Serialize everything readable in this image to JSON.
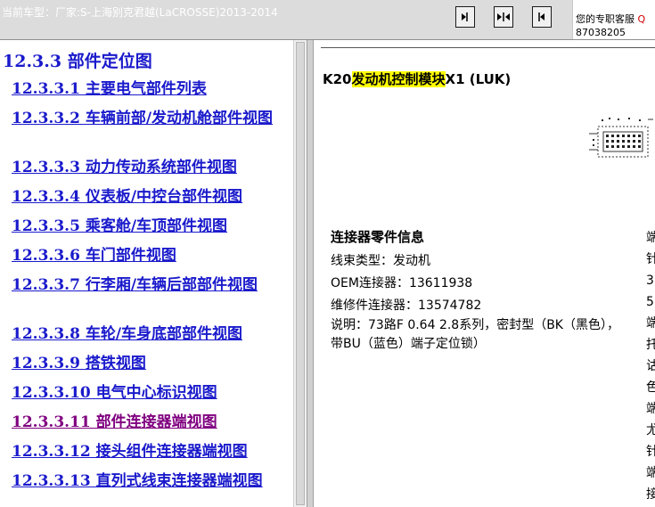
{
  "header": {
    "car_label": "当前车型：厂家:S-上海别克君越(LaCROSSE)2013-2014",
    "nav_buttons": [
      "prev-page",
      "sync-toc",
      "next-page"
    ]
  },
  "support": {
    "label": "您的专职客服",
    "label_cut": "Q",
    "phone": "87038205"
  },
  "toc": {
    "title": "12.3.3  部件定位图",
    "items": [
      {
        "label": "12.3.3.1  主要电气部件列表"
      },
      {
        "label": "12.3.3.2  车辆前部/发动机舱部件视图"
      },
      {
        "label": "12.3.3.3  动力传动系统部件视图"
      },
      {
        "label": "12.3.3.4  仪表板/中控台部件视图"
      },
      {
        "label": "12.3.3.5  乘客舱/车顶部件视图"
      },
      {
        "label": "12.3.3.6  车门部件视图"
      },
      {
        "label": "12.3.3.7  行李厢/车辆后部部件视图"
      },
      {
        "label": "12.3.3.8  车轮/车身底部部件视图"
      },
      {
        "label": "12.3.3.9  搭铁视图"
      },
      {
        "label": "12.3.3.10  电气中心标识视图"
      },
      {
        "label": "12.3.3.11  部件连接器端视图"
      },
      {
        "label": "12.3.3.12  接头组件连接器端视图"
      },
      {
        "label": "12.3.3.13  直列式线束连接器端视图"
      }
    ]
  },
  "content": {
    "title_prefix": "K20",
    "title_highlight": "发动机控制模块",
    "title_suffix": "X1 (LUK)",
    "section_heading": "连接器零件信息",
    "harness_type": "线束类型：发动机",
    "oem_connector": "OEM连接器：13611938",
    "service_connector": "维修件连接器：13574782",
    "description": "说明：73路F 0.64 2.8系列，密封型（BK（黑色），带BU（蓝色）端子定位锁）",
    "cut_column": [
      "端",
      "针",
      "3",
      "5",
      "端",
      "托",
      "诂",
      "色",
      "端",
      "尤",
      "针",
      "端",
      "接"
    ]
  },
  "colors": {
    "link": "#1a1acc",
    "visited_link": "#800080",
    "highlight": "#ffff00",
    "toolbar": "#dcdcdc"
  }
}
